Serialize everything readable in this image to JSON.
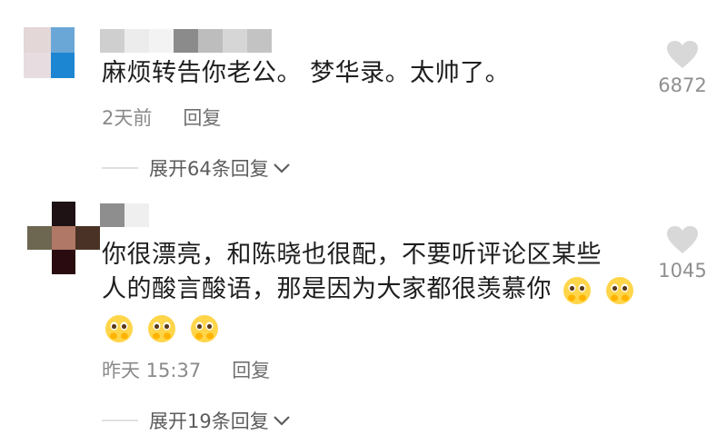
{
  "comments": [
    {
      "text": "麻烦转告你老公。 梦华录。太帅了。",
      "time": "2天前",
      "reply_label": "回复",
      "likes": "6872",
      "expand_label": "展开64条回复"
    },
    {
      "text_line1": "你很漂亮，和陈晓也很配，不要听评论区某些",
      "text_line2": "人的酸言酸语，那是因为大家都很羡慕你",
      "time": "昨天 15:37",
      "reply_label": "回复",
      "likes": "1045",
      "expand_label": "展开19条回复"
    }
  ],
  "colors": {
    "like_heart": "#d8d8d8",
    "meta_text": "#8a8a8a",
    "divider": "#e0e0e0",
    "emoji_face": "#ffd54a"
  },
  "icons": {
    "like": "heart-icon",
    "expand": "chevron-down-icon",
    "emoji": "pleading-face-emoji"
  }
}
